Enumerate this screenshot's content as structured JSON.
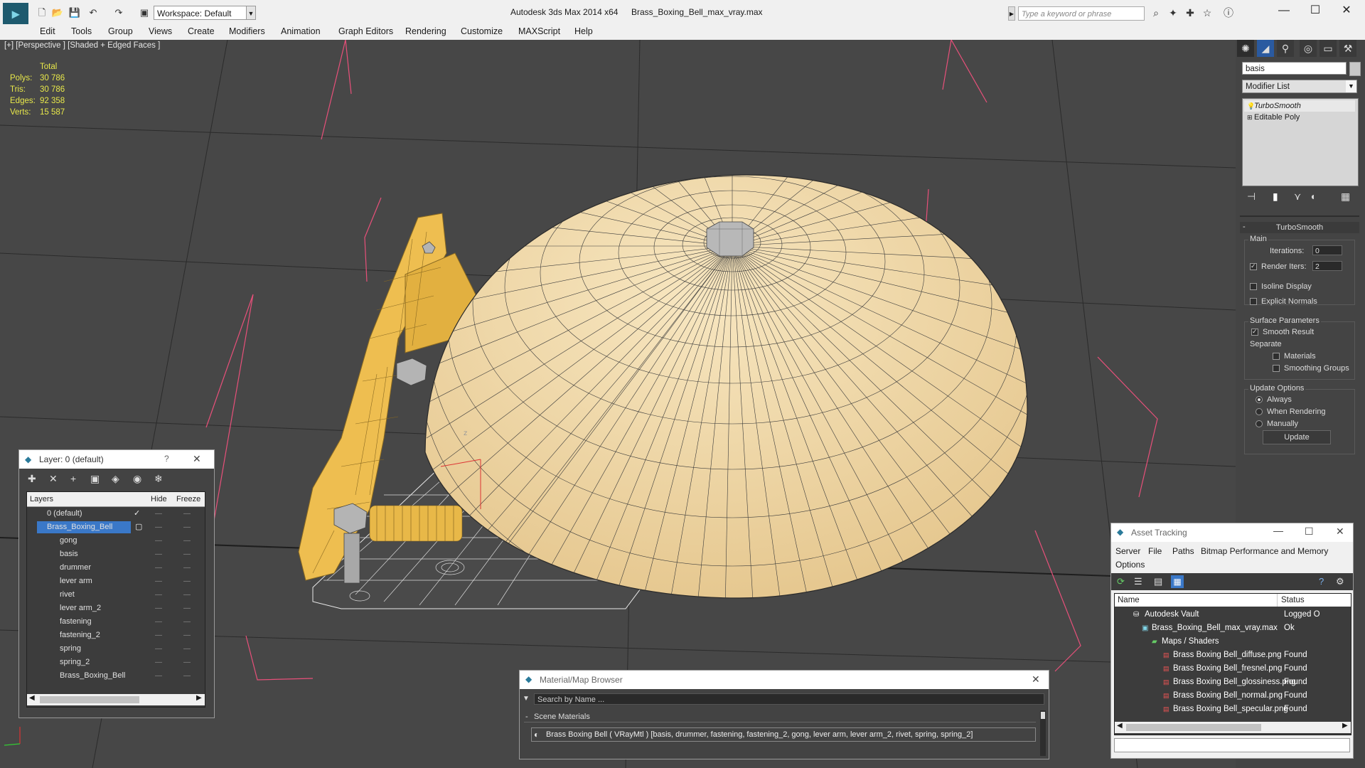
{
  "titlebar": {
    "workspace": "Workspace: Default",
    "app_title": "Autodesk 3ds Max  2014 x64",
    "file_title": "Brass_Boxing_Bell_max_vray.max",
    "search_placeholder": "Type a keyword or phrase"
  },
  "menu": [
    "Edit",
    "Tools",
    "Group",
    "Views",
    "Create",
    "Modifiers",
    "Animation",
    "Graph Editors",
    "Rendering",
    "Customize",
    "MAXScript",
    "Help"
  ],
  "viewport": {
    "label": "[+] [Perspective ] [Shaded + Edged Faces ]",
    "stats": {
      "header": "Total",
      "rows": [
        {
          "label": "Polys:",
          "value": "30 786"
        },
        {
          "label": "Tris:",
          "value": "30 786"
        },
        {
          "label": "Edges:",
          "value": "92 358"
        },
        {
          "label": "Verts:",
          "value": "15 587"
        }
      ]
    }
  },
  "command_panel": {
    "object_name": "basis",
    "modifier_list": "Modifier List",
    "stack": [
      "TurboSmooth",
      "Editable Poly"
    ],
    "rollout_title": "TurboSmooth",
    "main_group": "Main",
    "iterations_label": "Iterations:",
    "iterations_value": "0",
    "render_iters_label": "Render Iters:",
    "render_iters_value": "2",
    "isoline_display": "Isoline Display",
    "explicit_normals": "Explicit Normals",
    "surface_group": "Surface Parameters",
    "smooth_result": "Smooth Result",
    "separate": "Separate",
    "materials": "Materials",
    "smoothing_groups": "Smoothing Groups",
    "update_group": "Update Options",
    "always": "Always",
    "when_rendering": "When Rendering",
    "manually": "Manually",
    "update_button": "Update"
  },
  "layer_window": {
    "title": "Layer: 0 (default)",
    "help": "?",
    "col_layers": "Layers",
    "col_hide": "Hide",
    "col_freeze": "Freeze",
    "rows": [
      "0 (default)",
      "Brass_Boxing_Bell",
      "gong",
      "basis",
      "drummer",
      "lever arm",
      "rivet",
      "lever arm_2",
      "fastening",
      "fastening_2",
      "spring",
      "spring_2",
      "Brass_Boxing_Bell"
    ]
  },
  "material_browser": {
    "title": "Material/Map Browser",
    "search_placeholder": "Search by Name ...",
    "section": "Scene Materials",
    "item": "Brass Boxing Bell  ( VRayMtl )  [basis, drummer, fastening, fastening_2, gong, lever arm, lever arm_2, rivet, spring, spring_2]"
  },
  "asset_tracking": {
    "title": "Asset Tracking",
    "menu": [
      "Server",
      "File",
      "Paths",
      "Bitmap Performance and Memory",
      "Options"
    ],
    "col_name": "Name",
    "col_status": "Status",
    "rows": [
      {
        "name": "Autodesk Vault",
        "status": "Logged O"
      },
      {
        "name": "Brass_Boxing_Bell_max_vray.max",
        "status": "Ok"
      },
      {
        "name": "Maps / Shaders",
        "status": ""
      },
      {
        "name": "Brass Boxing Bell_diffuse.png",
        "status": "Found"
      },
      {
        "name": "Brass Boxing Bell_fresnel.png",
        "status": "Found"
      },
      {
        "name": "Brass Boxing Bell_glossiness.png",
        "status": "Found"
      },
      {
        "name": "Brass Boxing Bell_normal.png",
        "status": "Found"
      },
      {
        "name": "Brass Boxing Bell_specular.png",
        "status": "Found"
      }
    ]
  },
  "colors": {
    "bell": "#f2dcae",
    "wire": "#2a2a2a",
    "bracket": "#eebe50",
    "selection": "#3a78c8",
    "stats": "#e8e84a"
  }
}
